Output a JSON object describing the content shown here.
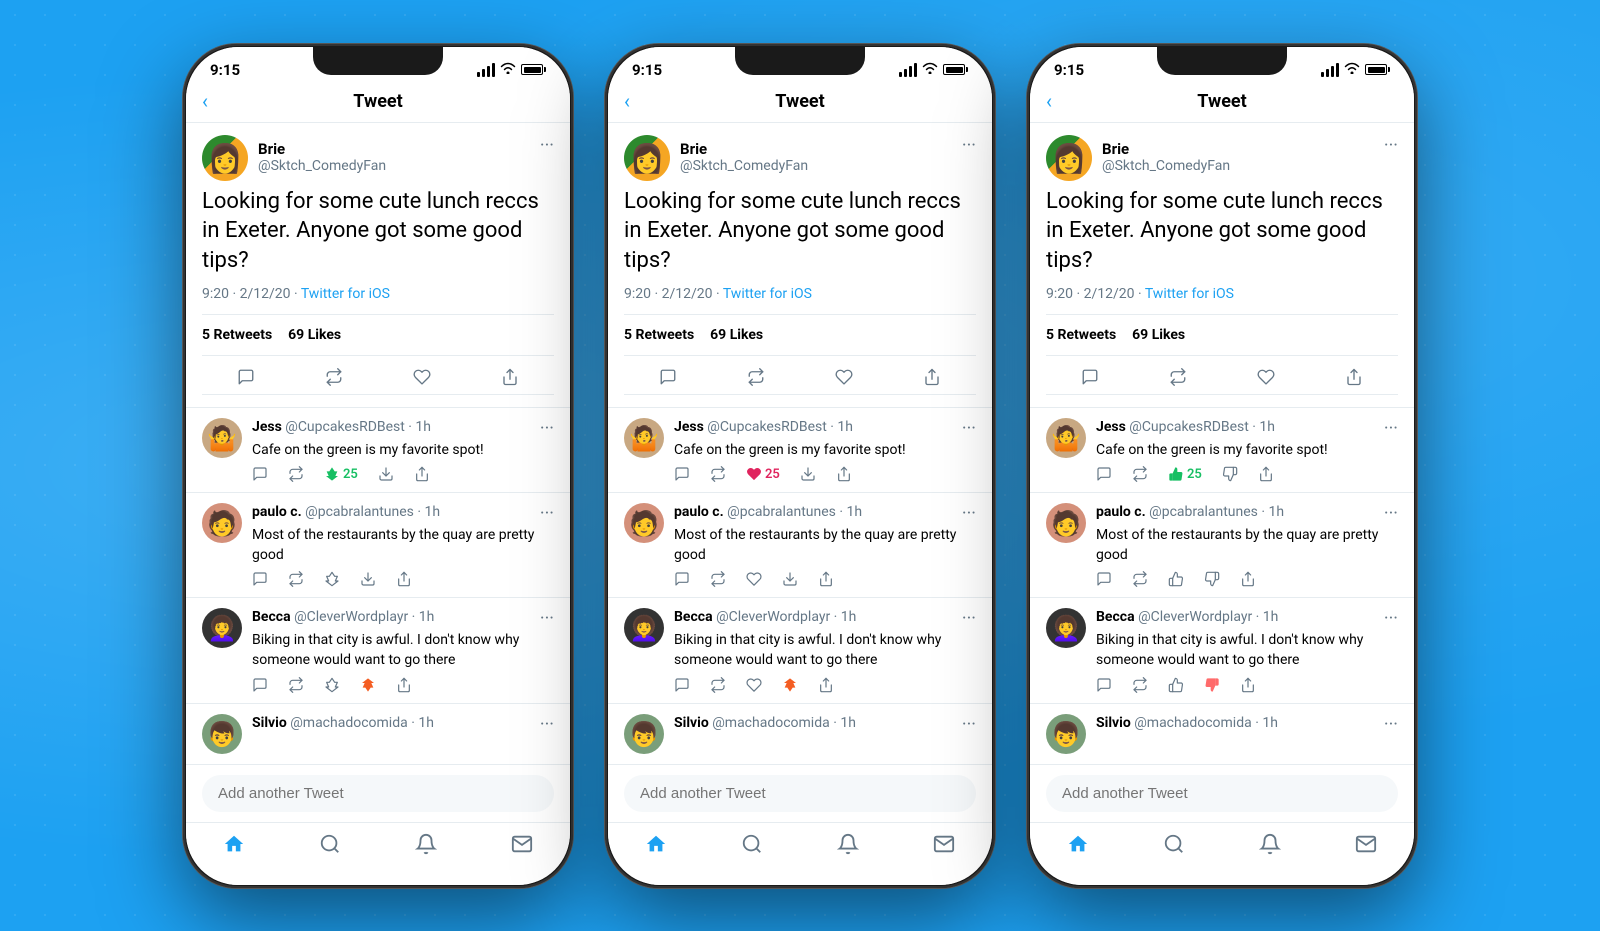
{
  "colors": {
    "background": "#1da1f2",
    "twitter_blue": "#1da1f2",
    "like_red": "#e0245e",
    "upvote_green": "#17bf63",
    "downvote_orange": "#f45d22",
    "downvote_red": "#ff6b6b",
    "text_primary": "#000000",
    "text_secondary": "#657786",
    "border": "#e6ecf0"
  },
  "phones": [
    {
      "id": "phone1",
      "variant": "upvote_downvote",
      "status_bar": {
        "time": "9:15",
        "signal": "●●●●",
        "wifi": "wifi",
        "battery": "battery"
      },
      "header": {
        "back_label": "‹",
        "title": "Tweet"
      },
      "main_tweet": {
        "user_name": "Brie",
        "user_handle": "@Sktch_ComedyFan",
        "text": "Looking for some cute lunch reccs in Exeter. Anyone got some good tips?",
        "time": "9:20 · 2/12/20 · ",
        "link": "Twitter for iOS",
        "retweets": "5",
        "retweets_label": "Retweets",
        "likes": "69",
        "likes_label": "Likes"
      },
      "replies": [
        {
          "name": "Jess",
          "handle": "@CupcakesRDBest · 1h",
          "text": "Cafe on the green is my favorite spot!",
          "action_type": "upvote",
          "count": "25",
          "avatar": "jess"
        },
        {
          "name": "paulo c.",
          "handle": "@pcabralantunes · 1h",
          "text": "Most of the restaurants by the quay are pretty good",
          "action_type": "neutral",
          "count": "",
          "avatar": "paulo"
        },
        {
          "name": "Becca",
          "handle": "@CleverWordplayr · 1h",
          "text": "Biking in that city is awful. I don't know why someone would want to go there",
          "action_type": "downvote",
          "count": "",
          "avatar": "becca"
        },
        {
          "name": "Silvio",
          "handle": "@machadocomida · 1h",
          "text": "",
          "action_type": "neutral",
          "avatar": "silvio"
        }
      ],
      "add_tweet_placeholder": "Add another Tweet",
      "bottom_nav": [
        "home",
        "search",
        "notifications",
        "mail"
      ]
    },
    {
      "id": "phone2",
      "variant": "heart_like",
      "status_bar": {
        "time": "9:15",
        "signal": "●●●●",
        "wifi": "wifi",
        "battery": "battery"
      },
      "header": {
        "back_label": "‹",
        "title": "Tweet"
      },
      "main_tweet": {
        "user_name": "Brie",
        "user_handle": "@Sktch_ComedyFan",
        "text": "Looking for some cute lunch reccs in Exeter. Anyone got some good tips?",
        "time": "9:20 · 2/12/20 · ",
        "link": "Twitter for iOS",
        "retweets": "5",
        "retweets_label": "Retweets",
        "likes": "69",
        "likes_label": "Likes"
      },
      "replies": [
        {
          "name": "Jess",
          "handle": "@CupcakesRDBest · 1h",
          "text": "Cafe on the green is my favorite spot!",
          "action_type": "heart_liked",
          "count": "25",
          "avatar": "jess"
        },
        {
          "name": "paulo c.",
          "handle": "@pcabralantunes · 1h",
          "text": "Most of the restaurants by the quay are pretty good",
          "action_type": "neutral",
          "count": "",
          "avatar": "paulo"
        },
        {
          "name": "Becca",
          "handle": "@CleverWordplayr · 1h",
          "text": "Biking in that city is awful. I don't know why someone would want to go there",
          "action_type": "down_orange",
          "count": "",
          "avatar": "becca"
        },
        {
          "name": "Silvio",
          "handle": "@machadocomida · 1h",
          "text": "",
          "action_type": "neutral",
          "avatar": "silvio"
        }
      ],
      "add_tweet_placeholder": "Add another Tweet",
      "bottom_nav": [
        "home",
        "search",
        "notifications",
        "mail"
      ]
    },
    {
      "id": "phone3",
      "variant": "thumbs",
      "status_bar": {
        "time": "9:15",
        "signal": "●●●●",
        "wifi": "wifi",
        "battery": "battery"
      },
      "header": {
        "back_label": "‹",
        "title": "Tweet"
      },
      "main_tweet": {
        "user_name": "Brie",
        "user_handle": "@Sktch_ComedyFan",
        "text": "Looking for some cute lunch reccs in Exeter. Anyone got some good tips?",
        "time": "9:20 · 2/12/20 · ",
        "link": "Twitter for iOS",
        "retweets": "5",
        "retweets_label": "Retweets",
        "likes": "69",
        "likes_label": "Likes"
      },
      "replies": [
        {
          "name": "Jess",
          "handle": "@CupcakesRDBest · 1h",
          "text": "Cafe on the green is my favorite spot!",
          "action_type": "thumbs_up",
          "count": "25",
          "avatar": "jess"
        },
        {
          "name": "paulo c.",
          "handle": "@pcabralantunes · 1h",
          "text": "Most of the restaurants by the quay are pretty good",
          "action_type": "neutral_thumbs",
          "count": "",
          "avatar": "paulo"
        },
        {
          "name": "Becca",
          "handle": "@CleverWordplayr · 1h",
          "text": "Biking in that city is awful. I don't know why someone would want to go there",
          "action_type": "thumbs_down_active",
          "count": "",
          "avatar": "becca"
        },
        {
          "name": "Silvio",
          "handle": "@machadocomida · 1h",
          "text": "",
          "action_type": "neutral_thumbs",
          "avatar": "silvio"
        }
      ],
      "add_tweet_placeholder": "Add another Tweet",
      "bottom_nav": [
        "home",
        "search",
        "notifications",
        "mail"
      ]
    }
  ]
}
